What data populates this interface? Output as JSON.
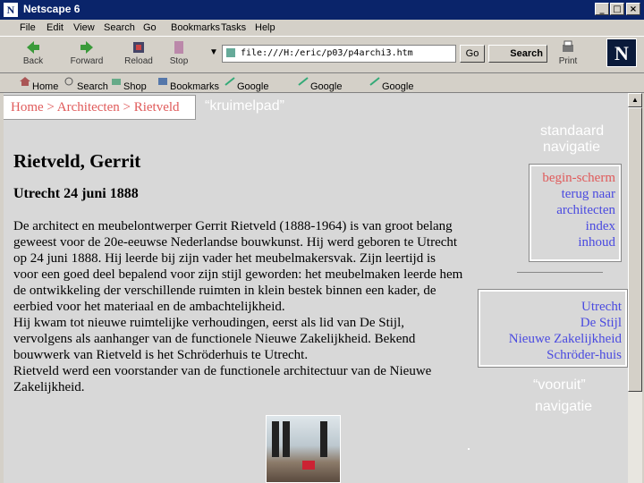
{
  "window": {
    "title": "Netscape 6",
    "app_icon": "N",
    "min": "_",
    "max": "□",
    "close": "×"
  },
  "menu": [
    "File",
    "Edit",
    "View",
    "Search",
    "Go",
    "Bookmarks",
    "Tasks",
    "Help"
  ],
  "toolbar": {
    "back": "Back",
    "forward": "Forward",
    "reload": "Reload",
    "stop": "Stop",
    "url": "file:///H:/eric/p03/p4archi3.htm",
    "go": "Go",
    "search": "Search",
    "print": "Print",
    "logo": "N"
  },
  "personal": {
    "home": "Home",
    "search": "Search",
    "shop": "Shop",
    "bookmarks": "Bookmarks",
    "google_search": "Google Search",
    "google_scout": "Google Scout",
    "google": "Google"
  },
  "page": {
    "breadcrumb": "Home > Architecten > Rietveld",
    "annot_breadcrumb": "“kruimelpad”",
    "annot_std_1": "standaard",
    "annot_std_2": "navigatie",
    "annot_fwd_1": "“vooruit”",
    "annot_fwd_2": "navigatie",
    "heading": "Rietveld, Gerrit",
    "subheading": "Utrecht 24 juni 1888",
    "paragraph_lines": [
      "De architect en meubelontwerper Gerrit Rietveld (1888-1964) is van groot belang",
      "geweest voor de 20e-eeuwse Nederlandse bouwkunst. Hij werd geboren te Utrecht",
      "op 24 juni 1888. Hij leerde bij zijn vader het meubelmakersvak. Zijn leertijd is",
      "voor een goed deel bepalend voor zijn stijl geworden: het meubelmaken leerde hem",
      "de ontwikkeling der verschillende ruimten in klein bestek binnen een kader, de",
      "eerbied voor het materiaal en de ambachtelijkheid.",
      "Hij kwam tot nieuwe ruimtelijke verhoudingen, eerst als lid van De Stijl,",
      "vervolgens als aanhanger van de functionele Nieuwe Zakelijkheid. Bekend",
      "bouwwerk van Rietveld is het Schröderhuis te Utrecht.",
      "Rietveld werd een voorstander van de functionele architectuur van de Nieuwe",
      "Zakelijkheid."
    ],
    "std_nav": [
      "begin-scherm",
      "terug naar",
      "architecten",
      "index",
      "inhoud"
    ],
    "fwd_nav": [
      "Utrecht",
      "De Stijl",
      "Nieuwe Zakelijkheid",
      "Schröder-huis"
    ]
  },
  "colors": {
    "link": "#4a4ae0",
    "visited": "#e05a5a",
    "titlebar": "#0a246a"
  }
}
